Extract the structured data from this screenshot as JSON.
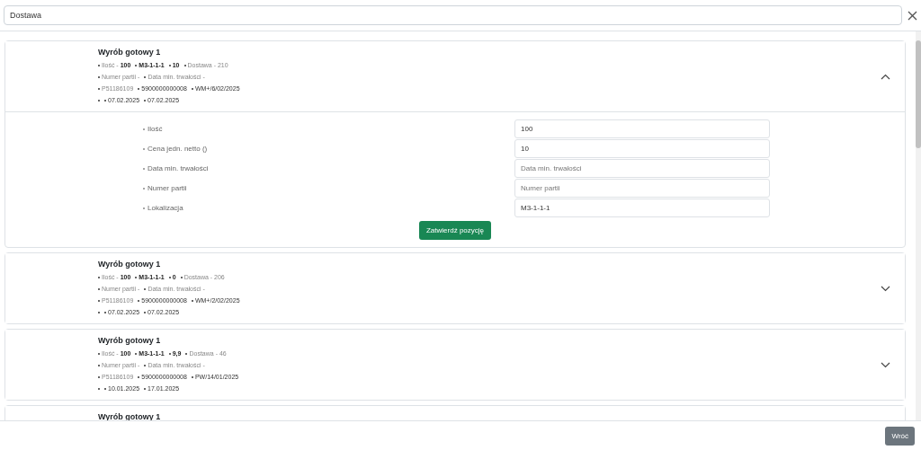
{
  "search": {
    "value": "Dostawa"
  },
  "items": [
    {
      "title": "Wyrób gotowy 1",
      "expanded": true,
      "lines": [
        [
          {
            "text": "Ilość - **100**",
            "kind": "label"
          },
          {
            "text": "M3-1-1-1",
            "kind": "value"
          },
          {
            "text": "10",
            "kind": "value"
          },
          {
            "text": "Dostawa - 210",
            "kind": "label"
          }
        ],
        [
          {
            "text": "Numer partii -",
            "kind": "label"
          },
          {
            "text": "Data min. trwałości -",
            "kind": "label"
          }
        ],
        [
          {
            "text": "P51186109",
            "kind": "label"
          },
          {
            "text": "5900000000008",
            "kind": "code"
          },
          {
            "text": "WM+/6/02/2025",
            "kind": "code"
          }
        ],
        [
          {
            "kind": "blank"
          },
          {
            "text": "07.02.2025",
            "kind": "code"
          },
          {
            "text": "07.02.2025",
            "kind": "code"
          }
        ]
      ],
      "fields": [
        {
          "label": "Ilość",
          "value": "100"
        },
        {
          "label": "Cena jedn. netto ()",
          "value": "10"
        },
        {
          "label": "Data min. trwałości",
          "placeholder": "Data min. trwałości"
        },
        {
          "label": "Numer partii",
          "placeholder": "Numer partii"
        },
        {
          "label": "Lokalizacja",
          "value": "M3-1-1-1"
        }
      ],
      "confirm_button": "Zatwierdź pozycję"
    },
    {
      "title": "Wyrób gotowy 1",
      "expanded": false,
      "lines": [
        [
          {
            "text": "Ilość - **100**",
            "kind": "label"
          },
          {
            "text": "M3-1-1-1",
            "kind": "value"
          },
          {
            "text": "0",
            "kind": "value"
          },
          {
            "text": "Dostawa - 206",
            "kind": "label"
          }
        ],
        [
          {
            "text": "Numer partii -",
            "kind": "label"
          },
          {
            "text": "Data min. trwałości -",
            "kind": "label"
          }
        ],
        [
          {
            "text": "P51186109",
            "kind": "label"
          },
          {
            "text": "5900000000008",
            "kind": "code"
          },
          {
            "text": "WM+/2/02/2025",
            "kind": "code"
          }
        ],
        [
          {
            "kind": "blank"
          },
          {
            "text": "07.02.2025",
            "kind": "code"
          },
          {
            "text": "07.02.2025",
            "kind": "code"
          }
        ]
      ]
    },
    {
      "title": "Wyrób gotowy 1",
      "expanded": false,
      "lines": [
        [
          {
            "text": "Ilość - **100**",
            "kind": "label"
          },
          {
            "text": "M3-1-1-1",
            "kind": "value"
          },
          {
            "text": "9,9",
            "kind": "value"
          },
          {
            "text": "Dostawa - 46",
            "kind": "label"
          }
        ],
        [
          {
            "text": "Numer partii -",
            "kind": "label"
          },
          {
            "text": "Data min. trwałości -",
            "kind": "label"
          }
        ],
        [
          {
            "text": "P51186109",
            "kind": "label"
          },
          {
            "text": "5900000000008",
            "kind": "code"
          },
          {
            "text": "PW/14/01/2025",
            "kind": "code"
          }
        ],
        [
          {
            "kind": "blank"
          },
          {
            "text": "10.01.2025",
            "kind": "code"
          },
          {
            "text": "17.01.2025",
            "kind": "code"
          }
        ]
      ]
    },
    {
      "title": "Wyrób gotowy 1"
    }
  ],
  "back_button": "Wróć"
}
